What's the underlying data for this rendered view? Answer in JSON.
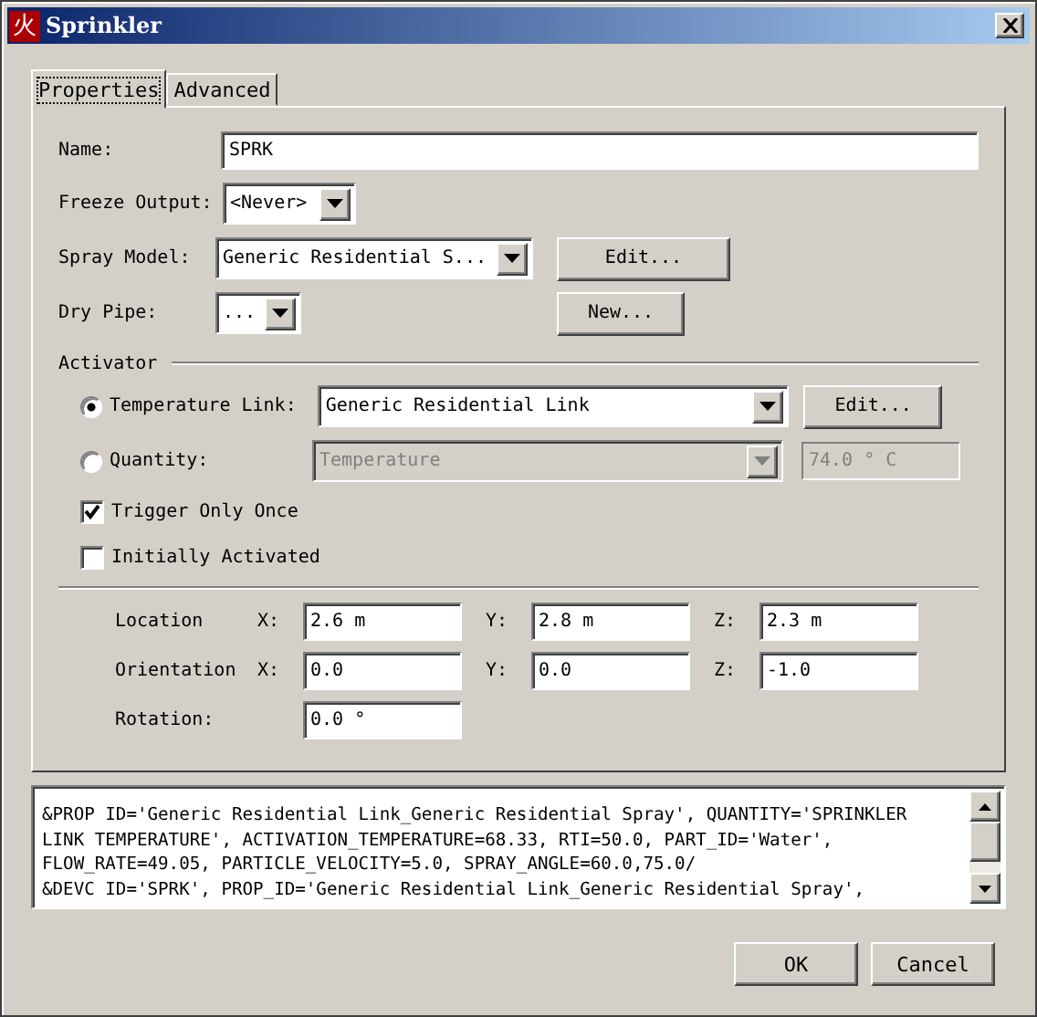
{
  "window": {
    "title": "Sprinkler",
    "icon_glyph": "火"
  },
  "tabs": [
    {
      "label": "Properties",
      "selected": true
    },
    {
      "label": "Advanced",
      "selected": false
    }
  ],
  "name": {
    "label": "Name:",
    "value": "SPRK"
  },
  "freeze_output": {
    "label": "Freeze Output:",
    "value": "<Never>"
  },
  "spray_model": {
    "label": "Spray Model:",
    "value": "Generic Residential S...",
    "button": "Edit..."
  },
  "dry_pipe": {
    "label": "Dry Pipe:",
    "value": "...",
    "button": "New..."
  },
  "activator": {
    "title": "Activator",
    "temperature_link": {
      "label": "Temperature Link:",
      "selected": true,
      "value": "Generic Residential Link",
      "button": "Edit..."
    },
    "quantity": {
      "label": "Quantity:",
      "selected": false,
      "disabled": true,
      "value": "Temperature",
      "reading": "74.0 ° C"
    },
    "checkboxes": [
      {
        "label": "Trigger Only Once",
        "checked": true
      },
      {
        "label": "Initially Activated",
        "checked": false
      }
    ]
  },
  "placement": [
    {
      "label": "Location",
      "fields": [
        {
          "axis": "X:",
          "value": "2.6 m"
        },
        {
          "axis": "Y:",
          "value": "2.8 m"
        },
        {
          "axis": "Z:",
          "value": "2.3 m"
        }
      ]
    },
    {
      "label": "Orientation",
      "fields": [
        {
          "axis": "X:",
          "value": "0.0"
        },
        {
          "axis": "Y:",
          "value": "0.0"
        },
        {
          "axis": "Z:",
          "value": "-1.0"
        }
      ]
    },
    {
      "label": "Rotation:",
      "fields": [
        {
          "value": "0.0 °"
        }
      ]
    }
  ],
  "fds_output": [
    "&PROP ID='Generic Residential Link_Generic Residential Spray', QUANTITY='SPRINKLER",
    "LINK TEMPERATURE', ACTIVATION_TEMPERATURE=68.33, RTI=50.0, PART_ID='Water',",
    "FLOW_RATE=49.05, PARTICLE_VELOCITY=5.0, SPRAY_ANGLE=60.0,75.0/",
    "&DEVC ID='SPRK', PROP_ID='Generic Residential Link_Generic Residential Spray',"
  ],
  "buttons": [
    "OK",
    "Cancel"
  ]
}
